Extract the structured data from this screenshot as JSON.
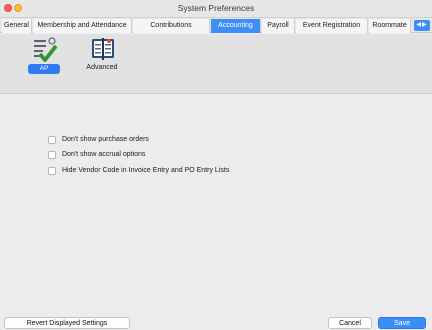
{
  "window": {
    "title": "System Preferences"
  },
  "tabs": [
    {
      "label": "General"
    },
    {
      "label": "Membership and Attendance"
    },
    {
      "label": "Contributions"
    },
    {
      "label": "Accounting",
      "selected": true
    },
    {
      "label": "Payroll"
    },
    {
      "label": "Event Registration"
    },
    {
      "label": "Roommate"
    }
  ],
  "toolbar": {
    "items": [
      {
        "label": "AP",
        "icon": "ap-checklist-icon",
        "selected": true
      },
      {
        "label": "Advanced",
        "icon": "advanced-ledger-icon",
        "selected": false
      }
    ]
  },
  "options": [
    {
      "label": "Don't show purchase orders",
      "checked": false
    },
    {
      "label": "Don't show accrual options",
      "checked": false
    },
    {
      "label": "Hide Vendor Code in Invoice Entry and PO Entry Lists",
      "checked": false
    }
  ],
  "footer": {
    "revert_label": "Revert Displayed Settings",
    "cancel_label": "Cancel",
    "save_label": "Save"
  },
  "colors": {
    "accent": "#3d8ff6",
    "window_bg": "#ececec"
  }
}
